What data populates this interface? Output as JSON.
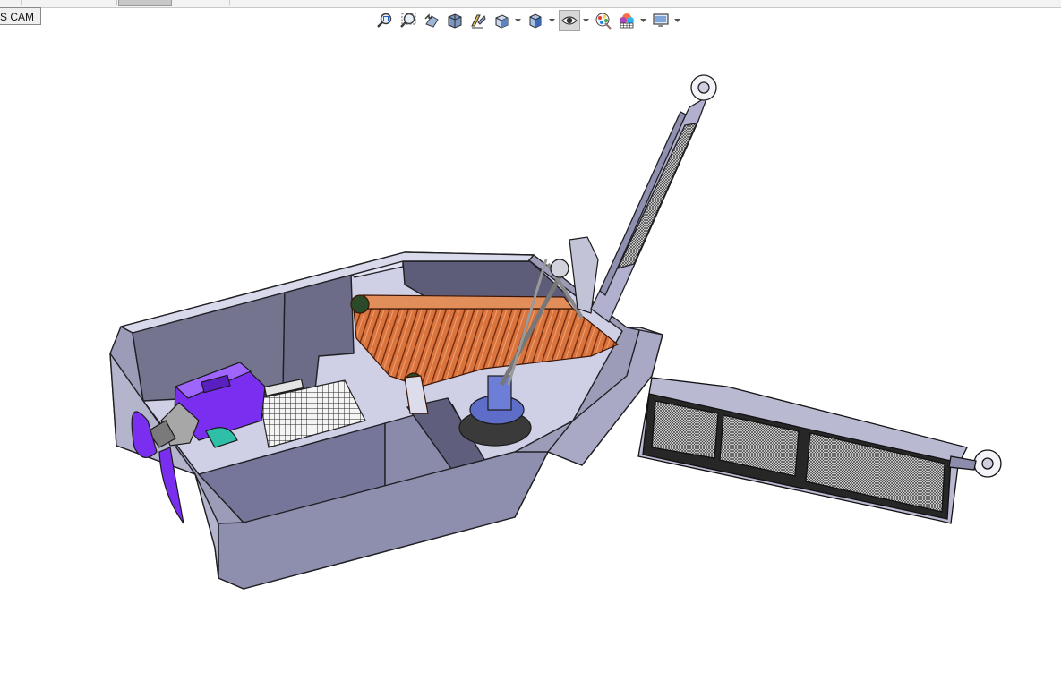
{
  "tabs": {
    "cam_label": "S CAM"
  },
  "heads_up_toolbar": {
    "buttons": [
      {
        "name": "zoom-to-fit-icon"
      },
      {
        "name": "zoom-to-area-icon"
      },
      {
        "name": "previous-view-icon"
      },
      {
        "name": "section-view-icon"
      },
      {
        "name": "dynamic-annotation-icon"
      },
      {
        "name": "view-orientation-icon"
      },
      {
        "name": "display-style-icon"
      },
      {
        "name": "hide-show-items-icon"
      },
      {
        "name": "edit-appearance-icon"
      },
      {
        "name": "apply-scene-icon"
      },
      {
        "name": "view-settings-icon"
      }
    ]
  },
  "model": {
    "description_name": "boat-conveyor-assembly"
  }
}
